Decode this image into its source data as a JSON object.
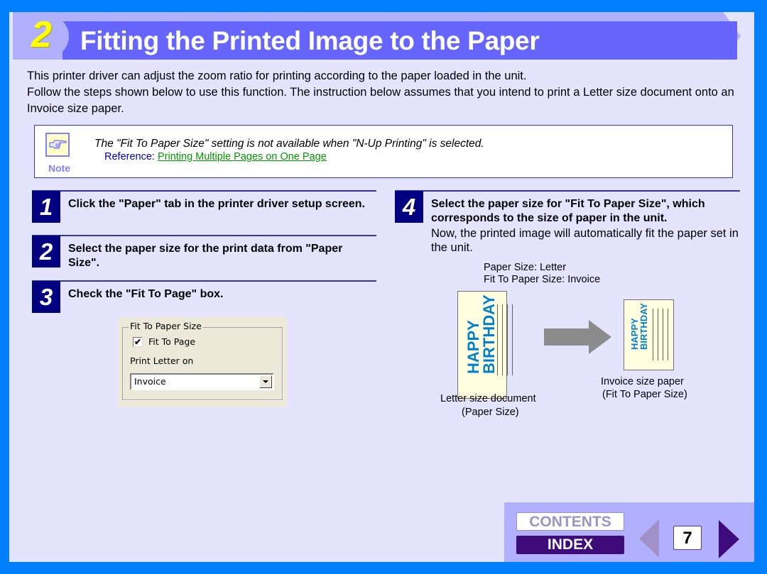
{
  "header": {
    "section_number": "2",
    "title": "Fitting the Printed Image to the Paper"
  },
  "intro": {
    "line1": "This printer driver can adjust the zoom ratio for printing according to the paper loaded in the unit.",
    "line2": "Follow the steps shown below to use this function. The instruction below assumes that you intend to print a Letter size document onto an Invoice size paper."
  },
  "note": {
    "icon": "pointing-hand-icon",
    "label": "Note",
    "text": "The \"Fit To Paper Size\" setting is not available when \"N-Up Printing\" is selected.",
    "reference_prefix": "Reference: ",
    "reference_link": "Printing Multiple Pages on One Page"
  },
  "steps": [
    {
      "number": "1",
      "text": "Click the \"Paper\" tab in the printer driver setup screen."
    },
    {
      "number": "2",
      "text": "Select the paper size for the print data from \"Paper Size\"."
    },
    {
      "number": "3",
      "text": "Check the \"Fit To Page\" box."
    },
    {
      "number": "4",
      "text": "Select the paper size for \"Fit To Paper Size\", which corresponds to the size of paper in the unit.",
      "subtext": "Now, the printed image will automatically fit the paper set in the unit."
    }
  ],
  "dialog": {
    "group_title": "Fit To Paper Size",
    "checkbox_label": "Fit To Page",
    "checkbox_checked": true,
    "select_label": "Print Letter on",
    "select_value": "Invoice"
  },
  "illustration": {
    "caption_paper_size": "Paper Size: Letter",
    "caption_fit_size": "Fit To Paper Size: Invoice",
    "doc_text_line1": "HAPPY",
    "doc_text_line2": "BIRTHDAY",
    "letter_caption_1": "Letter size document",
    "letter_caption_2": "(Paper Size)",
    "invoice_caption_1": "Invoice size paper",
    "invoice_caption_2": "(Fit To Paper Size)"
  },
  "nav": {
    "contents_label": "CONTENTS",
    "index_label": "INDEX",
    "page_number": "7"
  },
  "colors": {
    "frame": "#0080FF",
    "page_bg": "#E4E4FF",
    "title_band": "#6666FF",
    "title_band_light": "#B0B0FF",
    "section_number": "#FFFF00",
    "step_badge": "#000080",
    "link": "#009900",
    "nav_dark": "#3F0A7A"
  }
}
